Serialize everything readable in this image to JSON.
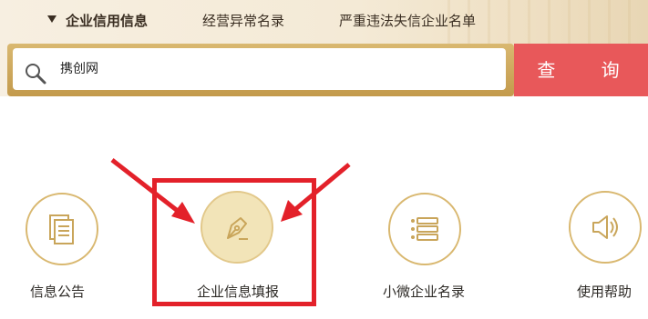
{
  "tabs": [
    {
      "label": "企业信用信息",
      "active": true
    },
    {
      "label": "经营异常名录",
      "active": false
    },
    {
      "label": "严重违法失信企业名单",
      "active": false
    }
  ],
  "search": {
    "value": "携创网",
    "button_label": "查 询"
  },
  "features": [
    {
      "label": "信息公告",
      "icon": "document-icon"
    },
    {
      "label": "企业信息填报",
      "icon": "pen-nib-icon"
    },
    {
      "label": "小微企业名录",
      "icon": "list-icon"
    },
    {
      "label": "使用帮助",
      "icon": "speaker-icon"
    }
  ],
  "colors": {
    "accent_gold": "#d9b870",
    "search_button": "#e8585a",
    "highlight_red": "#e3212a"
  }
}
